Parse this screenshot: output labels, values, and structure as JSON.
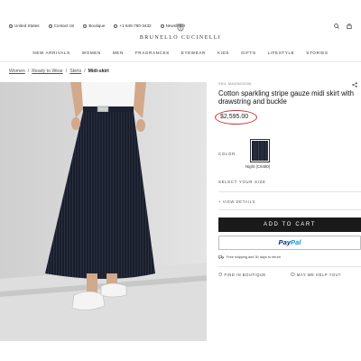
{
  "utility": {
    "country": "United States",
    "contact": "Contact Us",
    "boutique": "Boutique",
    "phone": "+1 646-760-3432",
    "newsletter": "Newsletter"
  },
  "brand": "BRUNELLO CUCINELLI",
  "nav": [
    "NEW ARRIVALS",
    "WOMEN",
    "MEN",
    "FRAGRANCES",
    "EYEWEAR",
    "KIDS",
    "GIFTS",
    "LIFESTYLE",
    "STORIES"
  ],
  "breadcrumb": [
    "Women",
    "Ready to Wear",
    "Skirts",
    "Midi-skirt"
  ],
  "product": {
    "sku": "SKU: MA036G3398",
    "title": "Cotton sparkling stripe gauze midi skirt with drawstring and buckle",
    "price": "$2,595.00",
    "color_label": "COLOR",
    "color_name": "Night (C6480)",
    "size_label": "SELECT YOUR SIZE",
    "view_details": "+ VIEW DETAILS",
    "add_to_cart": "ADD TO CART",
    "paypal_a": "Pay",
    "paypal_b": "Pal",
    "shipping": "Free shipping and 30 days to return",
    "find_boutique": "FIND IN BOUTIQUE",
    "help": "MAY WE HELP YOU?"
  },
  "colors": {
    "price_circle": "#cc3333",
    "cart_bg": "#1a1a1a",
    "paypal_dark": "#003087",
    "paypal_light": "#009cde"
  }
}
